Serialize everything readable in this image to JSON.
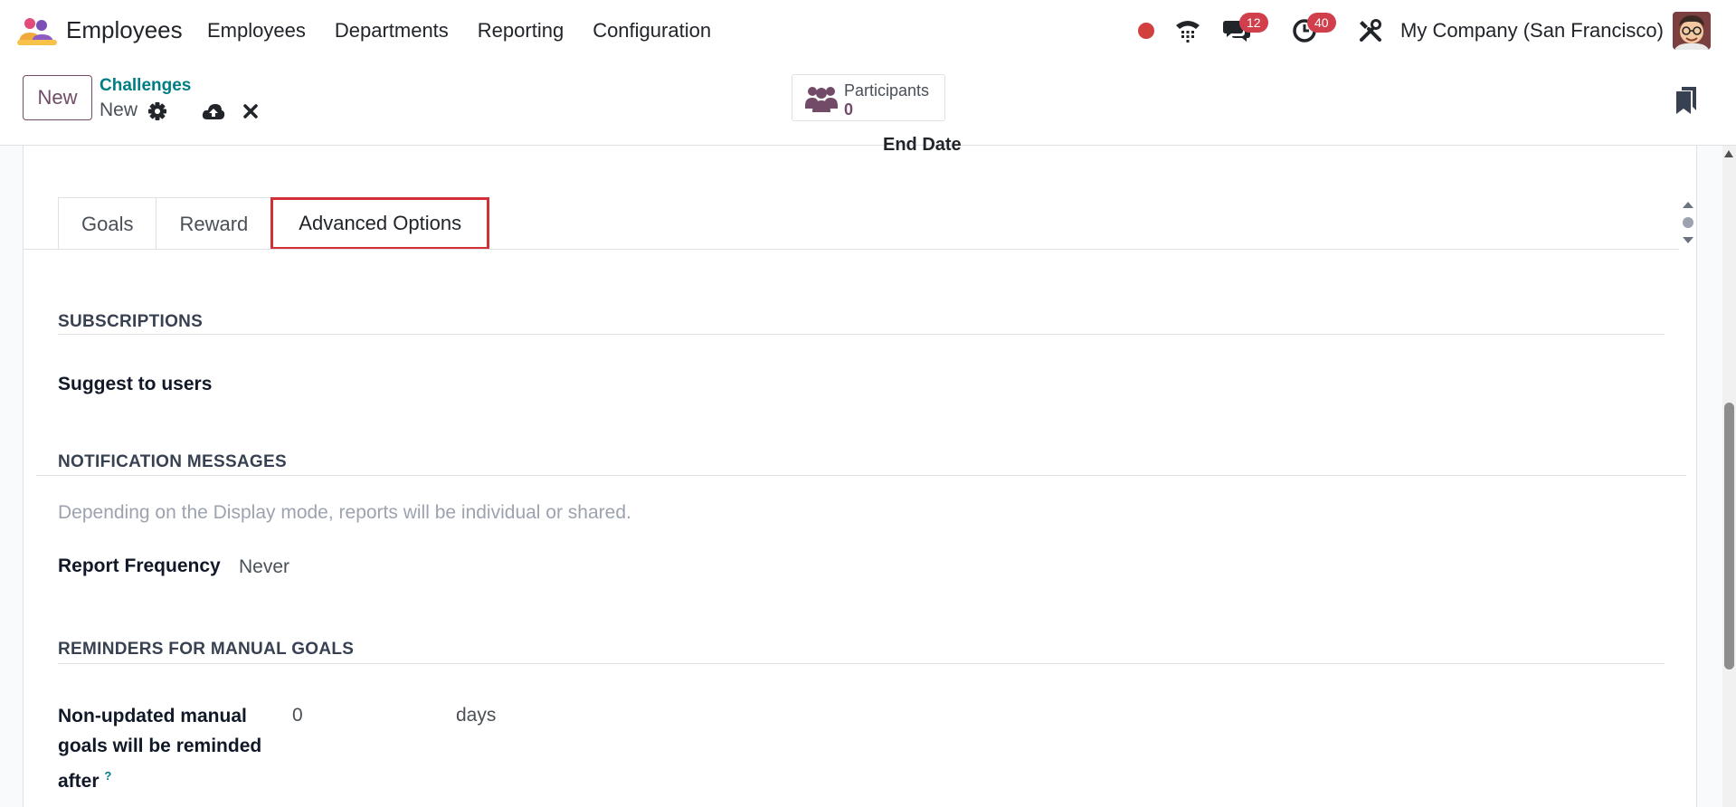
{
  "navbar": {
    "app_name": "Employees",
    "menu": [
      "Employees",
      "Departments",
      "Reporting",
      "Configuration"
    ],
    "messages_count": "12",
    "activities_count": "40",
    "company": "My Company (San Francisco)"
  },
  "control": {
    "new_label": "New",
    "breadcrumb_parent": "Challenges",
    "breadcrumb_current": "New",
    "stat_label": "Participants",
    "stat_value": "0"
  },
  "form": {
    "cut_label": "End Date",
    "tabs": [
      "Goals",
      "Reward",
      "Advanced Options"
    ],
    "active_tab": "Advanced Options",
    "subscriptions": {
      "title": "SUBSCRIPTIONS",
      "suggest_label": "Suggest to users"
    },
    "notifications": {
      "title": "NOTIFICATION MESSAGES",
      "help": "Depending on the Display mode, reports will be individual or shared.",
      "freq_label": "Report Frequency",
      "freq_value": "Never"
    },
    "reminders": {
      "title": "REMINDERS FOR MANUAL GOALS",
      "label_line1": "Non-updated manual",
      "label_line2": "goals will be reminded",
      "label_line3": "after",
      "help_mark": "?",
      "value": "0",
      "unit": "days"
    }
  },
  "colors": {
    "brand": "#714b67",
    "link": "#017e84",
    "highlight": "#d32f37",
    "badge": "#d23f4c"
  }
}
